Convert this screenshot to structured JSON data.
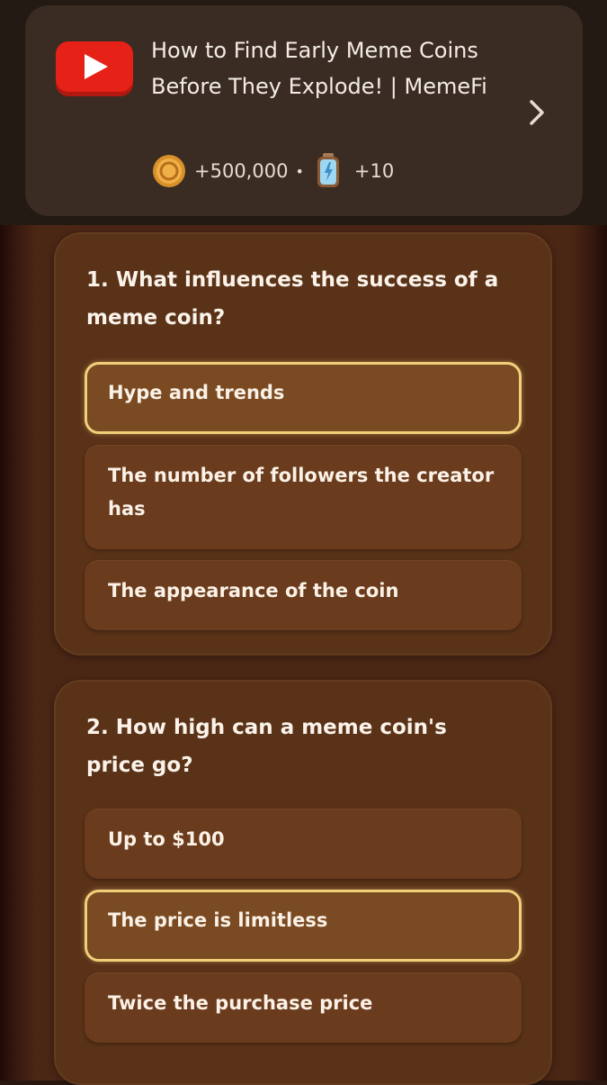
{
  "task": {
    "title": "How to Find Early Meme Coins Before They Explode! | MemeFi",
    "coin_reward": "+500,000",
    "separator": "•",
    "energy_reward": "+10"
  },
  "quiz": [
    {
      "question": "1. What influences the success of a meme coin?",
      "options": [
        {
          "label": "Hype and trends",
          "selected": true
        },
        {
          "label": "The number of followers the creator has",
          "selected": false
        },
        {
          "label": "The appearance of the coin",
          "selected": false
        }
      ]
    },
    {
      "question": "2. How high can a meme coin's price go?",
      "options": [
        {
          "label": "Up to $100",
          "selected": false
        },
        {
          "label": "The price is limitless",
          "selected": true
        },
        {
          "label": "Twice the purchase price",
          "selected": false
        }
      ]
    }
  ],
  "colors": {
    "youtube_red": "#e62117",
    "selected_border": "#f1cf7a",
    "card_bg": "#5a3218"
  }
}
